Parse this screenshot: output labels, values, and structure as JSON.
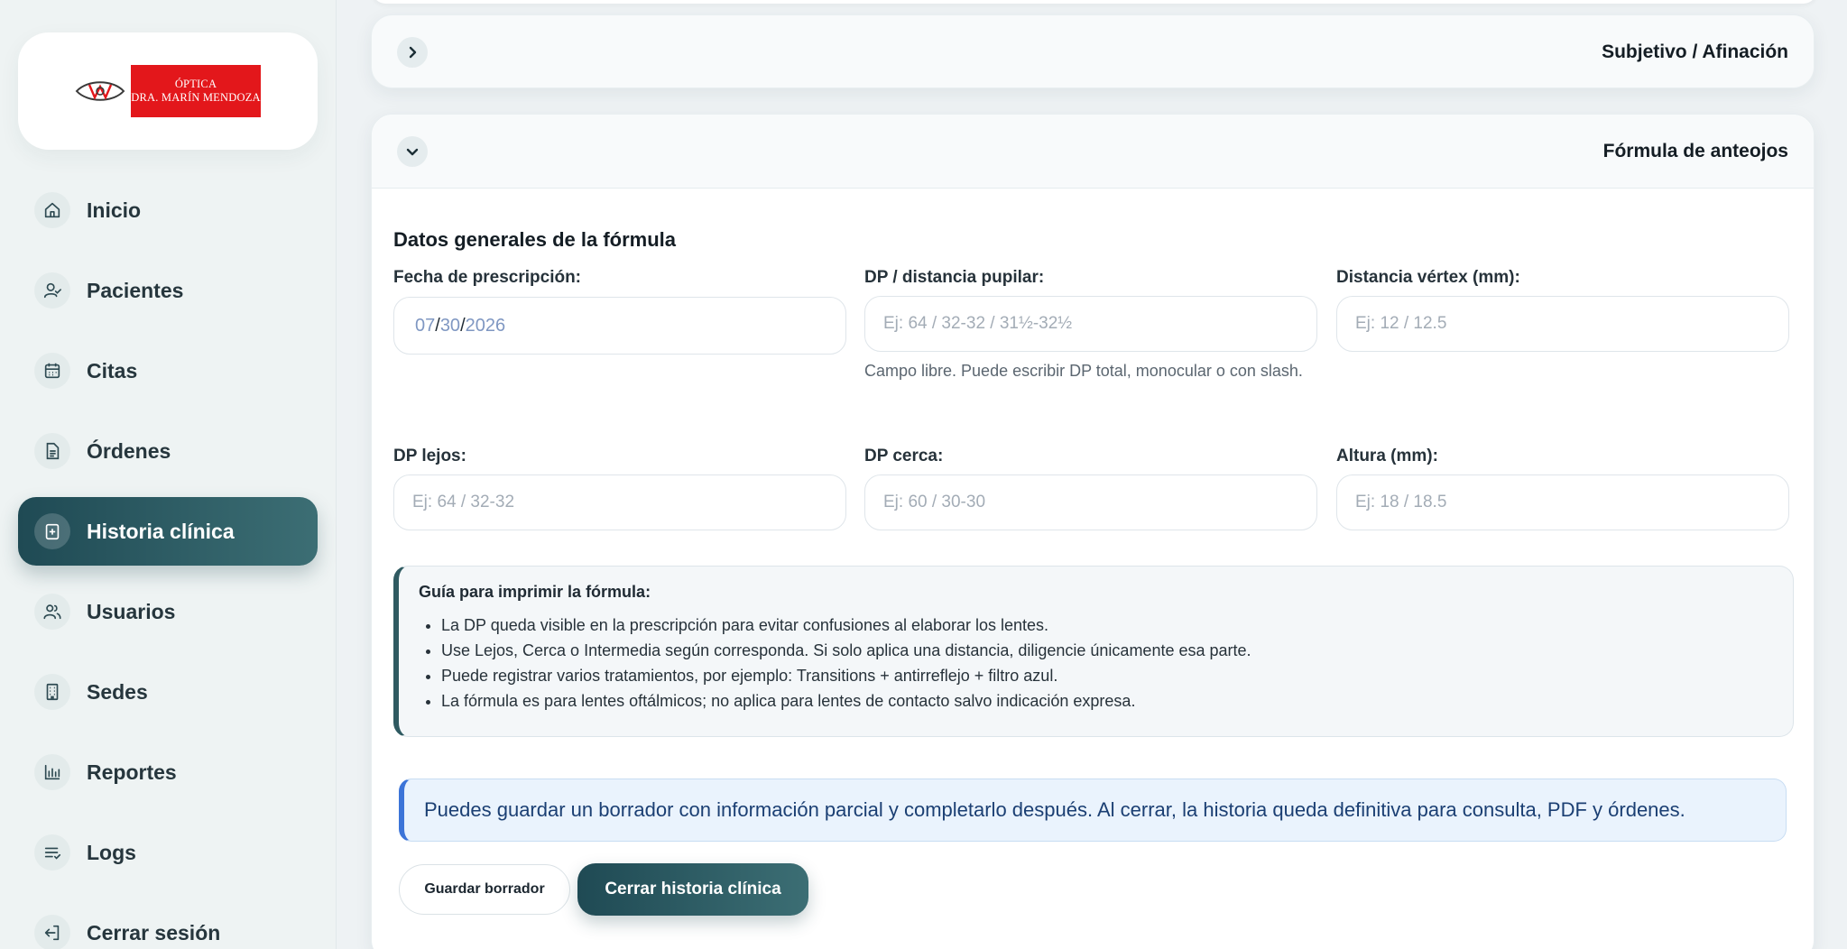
{
  "brand": {
    "logo_line1": "ÓPTICA",
    "logo_line2": "DRA. MARÍN MENDOZA",
    "brand_red": "#e3171b"
  },
  "sidebar": {
    "items": [
      {
        "label": "Inicio",
        "icon": "home-icon"
      },
      {
        "label": "Pacientes",
        "icon": "user-check-icon"
      },
      {
        "label": "Citas",
        "icon": "calendar-icon"
      },
      {
        "label": "Órdenes",
        "icon": "document-icon"
      },
      {
        "label": "Historia clínica",
        "icon": "medical-file-icon",
        "active": true
      },
      {
        "label": "Usuarios",
        "icon": "users-icon"
      },
      {
        "label": "Sedes",
        "icon": "building-icon"
      },
      {
        "label": "Reportes",
        "icon": "bar-chart-icon"
      },
      {
        "label": "Logs",
        "icon": "list-check-icon"
      },
      {
        "label": "Cerrar sesión",
        "icon": "logout-icon"
      }
    ],
    "accent": "#1f4a54"
  },
  "sections": {
    "subjetivo_title": "Subjetivo / Afinación",
    "formula_title": "Fórmula de anteojos"
  },
  "formula": {
    "group_title": "Datos generales de la fórmula",
    "fecha_label": "Fecha de prescripción:",
    "fecha_month": "07",
    "fecha_day": "30",
    "fecha_year": "2026",
    "dp_label": "DP / distancia pupilar:",
    "dp_placeholder": "Ej: 64 / 32-32 / 31½-32½",
    "dp_help": "Campo libre. Puede escribir DP total, monocular o con slash.",
    "vertex_label": "Distancia vértex (mm):",
    "vertex_placeholder": "Ej: 12 / 12.5",
    "dp_lejos_label": "DP lejos:",
    "dp_lejos_placeholder": "Ej: 64 / 32-32",
    "dp_cerca_label": "DP cerca:",
    "dp_cerca_placeholder": "Ej: 60 / 30-30",
    "altura_label": "Altura (mm):",
    "altura_placeholder": "Ej: 18 / 18.5"
  },
  "guide": {
    "title": "Guía para imprimir la fórmula:",
    "items": [
      "La DP queda visible en la prescripción para evitar confusiones al elaborar los lentes.",
      "Use Lejos, Cerca o Intermedia según corresponda. Si solo aplica una distancia, diligencie únicamente esa parte.",
      "Puede registrar varios tratamientos, por ejemplo: Transitions + antirreflejo + filtro azul.",
      "La fórmula es para lentes oftálmicos; no aplica para lentes de contacto salvo indicación expresa."
    ]
  },
  "notice": {
    "text": "Puedes guardar un borrador con información parcial y completarlo después. Al cerrar, la historia queda definitiva para consulta, PDF y órdenes."
  },
  "actions": {
    "draft_label": "Guardar borrador",
    "close_label": "Cerrar historia clínica"
  }
}
